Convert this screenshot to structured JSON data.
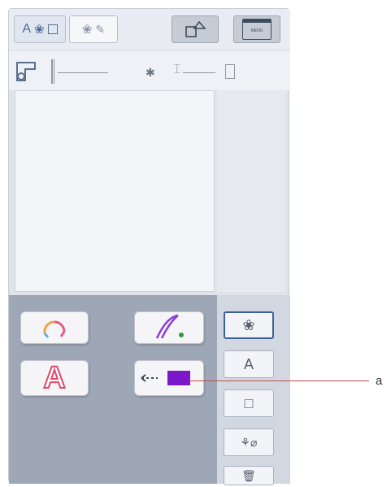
{
  "toolbar": {
    "tab_text_label": "A",
    "menu_icon_text": "MENU"
  },
  "side_buttons": [
    {
      "name": "pattern",
      "glyph": "❀"
    },
    {
      "name": "character",
      "glyph": "A"
    },
    {
      "name": "frame",
      "glyph": "□"
    },
    {
      "name": "edit",
      "glyph": "⚘⌀"
    },
    {
      "name": "delete",
      "glyph": "🗑"
    }
  ],
  "panel": {
    "text_tile_glyph": "A"
  },
  "callout": {
    "label": "a"
  },
  "colors": {
    "accent_purple": "#7a18c9",
    "pink_text": "#e0486b",
    "callout_red": "#c24a4a"
  }
}
